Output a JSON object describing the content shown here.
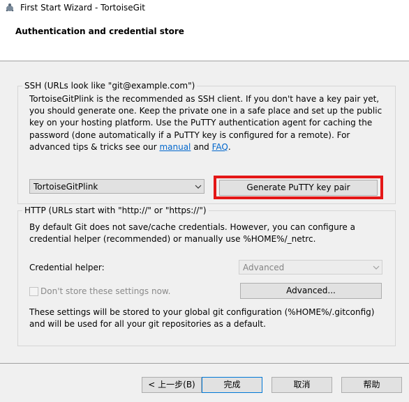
{
  "window": {
    "title": "First Start Wizard - TortoiseGit",
    "app_icon": "tortoisegit-icon"
  },
  "header": {
    "title": "Authentication and credential store"
  },
  "ssh": {
    "legend": "SSH (URLs look like \"git@example.com\")",
    "lines": [
      "TortoiseGitPlink is the recommended as SSH client. If you don't have a key pair yet,",
      "you should generate one. Keep the private one in a safe place and set up the public",
      "key on your hosting platform. Use the PuTTY authentication agent for caching the",
      "password (done automatically if a PuTTY key is configured for a remote). For"
    ],
    "line5_prefix": "advanced tips & tricks see our ",
    "manual_link": "manual",
    "and_text": " and ",
    "faq_link": "FAQ",
    "period": ".",
    "client_select": "TortoiseGitPlink",
    "generate_button": "Generate PuTTY  key pair",
    "highlight_color": "#e41717"
  },
  "http": {
    "legend": "HTTP (URLs start with \"http://\" or \"https://\")",
    "lines": [
      "By default Git does not save/cache credentials. However, you can configure a",
      "credential helper (recommended) or manually use %HOME%/_netrc."
    ],
    "credential_helper_label": "Credential helper:",
    "credential_helper_value": "Advanced",
    "dont_store_label": "Don't store these settings now.",
    "advanced_button": "Advanced...",
    "note_lines": [
      "These settings will be stored to your global git configuration (%HOME%/.gitconfig)",
      "and will be used for all your git repositories as a default."
    ]
  },
  "footer": {
    "back_button": "< 上一步(B)",
    "finish_button": "完成",
    "cancel_button": "取消",
    "help_button": "帮助"
  }
}
